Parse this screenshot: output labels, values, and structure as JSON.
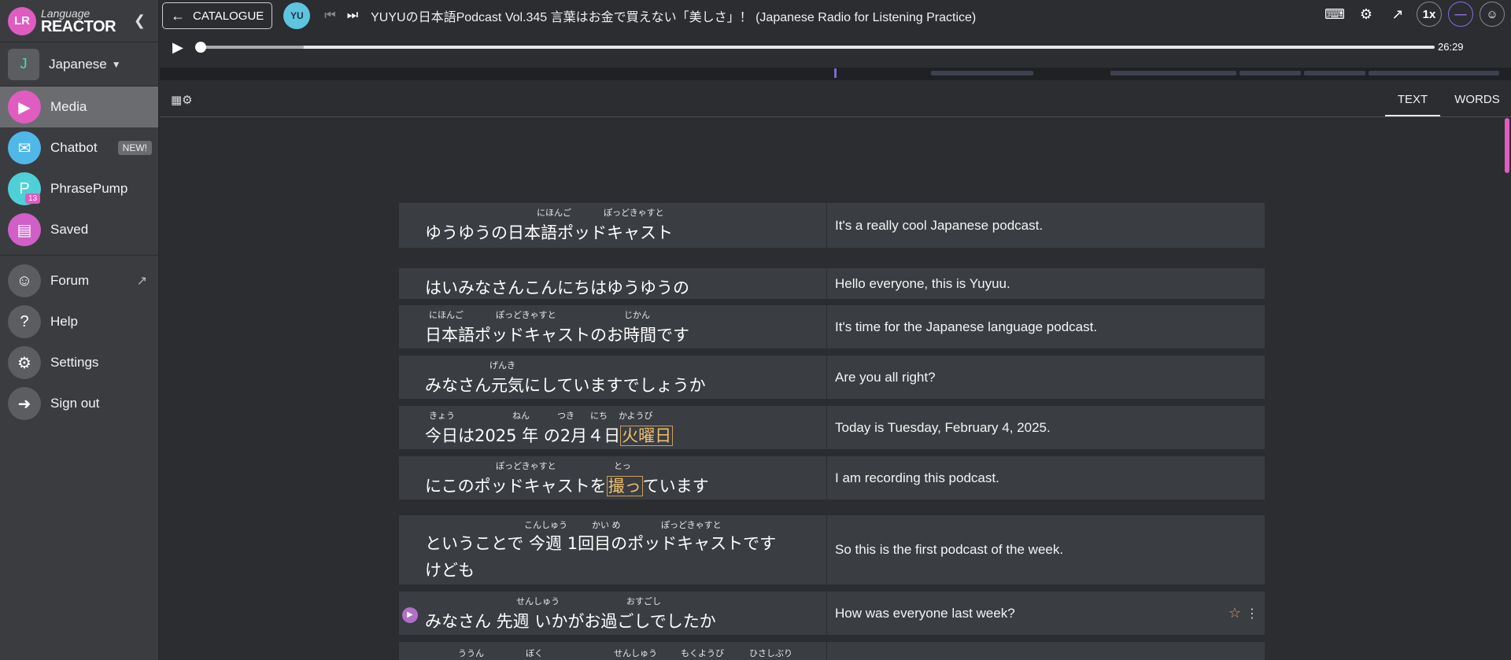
{
  "app": {
    "logo_initials": "LR",
    "logo_line1": "Language",
    "logo_line2": "REACTOR",
    "language_initial": "J",
    "language": "Japanese"
  },
  "sidebar": {
    "items": [
      {
        "label": "Media",
        "icon": "play-icon",
        "active": true
      },
      {
        "label": "Chatbot",
        "icon": "chat-icon",
        "badge": "NEW!"
      },
      {
        "label": "PhrasePump",
        "icon": "phrasepump-icon",
        "count": "13"
      },
      {
        "label": "Saved",
        "icon": "list-icon"
      },
      {
        "label": "Forum",
        "icon": "person-icon"
      },
      {
        "label": "Help",
        "icon": "help-icon"
      },
      {
        "label": "Settings",
        "icon": "gear-icon"
      },
      {
        "label": "Sign out",
        "icon": "signout-icon"
      }
    ]
  },
  "topbar": {
    "catalogue_label": "CATALOGUE",
    "title": "YUYUの日本語Podcast Vol.345 言葉はお金で買えない「美しさ」！ (Japanese Radio for Listening Practice)",
    "speed": "1x",
    "duration": "26:29",
    "progress_played": 0.0,
    "progress_buffered": 0.085
  },
  "content": {
    "tabs": [
      "TEXT",
      "WORDS"
    ]
  },
  "rows": [
    {
      "jp": "ゆうゆうの日本語ポッドキャスト",
      "furi": [
        [
          "にほんご",
          142
        ],
        [
          "ぽっどきゃすと",
          227
        ]
      ],
      "en": "It's a really cool Japanese podcast."
    },
    {
      "jp": "はいみなさんこんにちはゆうゆうの",
      "furi": [],
      "en": "Hello everyone, this is Yuyuu."
    },
    {
      "jp": "日本語ポッドキャストのお時間です",
      "furi": [
        [
          "にほんご",
          5
        ],
        [
          "ぽっどきゃすと",
          90
        ],
        [
          "じかん",
          253
        ]
      ],
      "en": "It's time for the Japanese language podcast."
    },
    {
      "jp": "みなさん元気にしていますでしょうか",
      "furi": [
        [
          "げんき",
          82
        ]
      ],
      "en": "Are you all right?"
    },
    {
      "jp_pre": "今日は2025 年 の2月４日",
      "jp_hl": "火曜日",
      "furi": [
        [
          "きょう",
          5
        ],
        [
          "ねん",
          111
        ],
        [
          "つき",
          168
        ],
        [
          "にち",
          210
        ],
        [
          "かようび",
          246
        ]
      ],
      "en": "Today is Tuesday, February 4, 2025."
    },
    {
      "jp_pre": "にこのポッドキャストを",
      "jp_hl": "撮っ",
      "jp_post": "ています",
      "furi": [
        [
          "ぽっどきゃすと",
          90
        ],
        [
          "とっ",
          240
        ]
      ],
      "en": "I am recording this podcast."
    },
    {
      "jp": "ということで 今週 1回目のポッドキャストです",
      "jp2": "けども",
      "furi": [
        [
          "こんしゅう",
          126
        ],
        [
          "かい め",
          212
        ],
        [
          "ぽっどきゃすと",
          300
        ]
      ],
      "en": "So this is the first podcast of the week."
    },
    {
      "jp": "みなさん 先週 いかがお過ごしでしたか",
      "furi": [
        [
          "せんしゅう",
          116
        ],
        [
          "おすごし",
          256
        ]
      ],
      "en": "How was everyone last week?"
    },
    {
      "jp": "",
      "furi": [
        [
          "ううん",
          42
        ],
        [
          "ぼく",
          128
        ],
        [
          "せんしゅう",
          240
        ],
        [
          "もくようび",
          325
        ],
        [
          "ひさしぶり",
          412
        ]
      ],
      "en": ""
    }
  ]
}
